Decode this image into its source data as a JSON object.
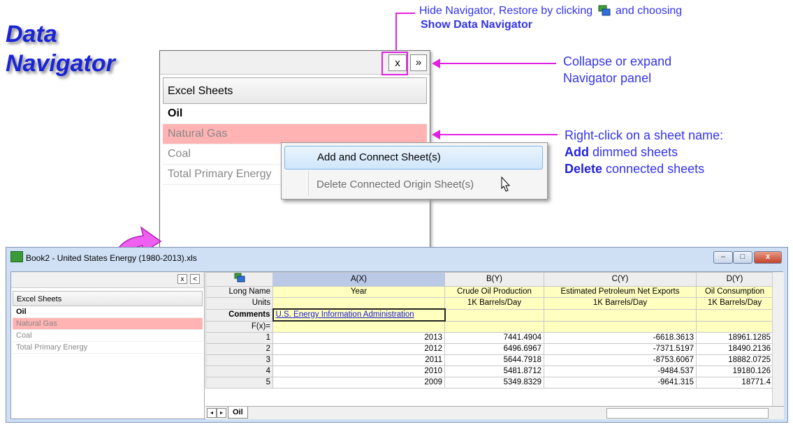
{
  "title": {
    "line1": "Data",
    "line2": "Navigator"
  },
  "annotations": {
    "hide_line1": "Hide Navigator, Restore by clicking",
    "hide_line1b": "and choosing",
    "hide_line2": "Show Data Navigator",
    "collapse_line1": "Collapse or expand",
    "collapse_line2": "Navigator panel",
    "right_click_line1": "Right-click on a sheet name:",
    "add_bold": "Add",
    "add_rest": "dimmed sheets",
    "delete_bold": "Delete",
    "delete_rest": "connected sheets"
  },
  "navigator": {
    "close_label": "x",
    "expand_label": "»",
    "header": "Excel Sheets",
    "sheets": [
      "Oil",
      "Natural Gas",
      "Coal",
      "Total Primary Energy"
    ]
  },
  "context_menu": {
    "item1": "Add and Connect Sheet(s)",
    "item2": "Delete Connected Origin Sheet(s)"
  },
  "book": {
    "title": "Book2 - United States Energy (1980-2013).xls",
    "min": "–",
    "max": "□",
    "close": "x",
    "nav_close": "x",
    "nav_collapse": "<",
    "nav_header": "Excel Sheets",
    "sheet_tab": "Oil",
    "columns": [
      "A(X)",
      "B(Y)",
      "C(Y)",
      "D(Y)"
    ],
    "row_labels": {
      "long_name": "Long Name",
      "units": "Units",
      "comments": "Comments",
      "fx": "F(x)="
    },
    "long_names": [
      "Year",
      "Crude Oil Production",
      "Estimated Petroleum Net Exports",
      "Oil Consumption"
    ],
    "units": [
      "",
      "1K Barrels/Day",
      "1K Barrels/Day",
      "1K Barrels/Day"
    ],
    "comment": "U.S. Energy Information Administration",
    "rows": [
      {
        "n": "1",
        "a": "2013",
        "b": "7441.4904",
        "c": "-6618.3613",
        "d": "18961.1285"
      },
      {
        "n": "2",
        "a": "2012",
        "b": "6496.6967",
        "c": "-7371.5197",
        "d": "18490.2136"
      },
      {
        "n": "3",
        "a": "2011",
        "b": "5644.7918",
        "c": "-8753.6067",
        "d": "18882.0725"
      },
      {
        "n": "4",
        "a": "2010",
        "b": "5481.8712",
        "c": "-9484.537",
        "d": "19180.126"
      },
      {
        "n": "5",
        "a": "2009",
        "b": "5349.8329",
        "c": "-9641.315",
        "d": "18771.4"
      }
    ]
  },
  "colors": {
    "accent": "#e020e0",
    "note_text": "#3333ee",
    "selected_row": "#ffb3b3"
  }
}
